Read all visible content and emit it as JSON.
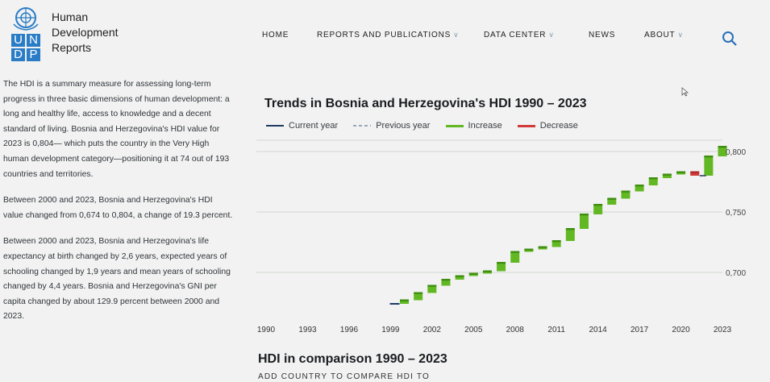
{
  "logo": {
    "letters": [
      "U",
      "N",
      "D",
      "P"
    ],
    "name_lines": [
      "Human",
      "Development",
      "Reports"
    ]
  },
  "nav": {
    "items": [
      {
        "label": "HOME",
        "dropdown": false
      },
      {
        "label": "REPORTS AND PUBLICATIONS",
        "dropdown": true
      },
      {
        "label": "DATA CENTER",
        "dropdown": true
      },
      {
        "label": "NEWS",
        "dropdown": false
      },
      {
        "label": "ABOUT",
        "dropdown": true
      }
    ],
    "search_icon": "search-icon"
  },
  "intro": {
    "paragraphs": [
      "The HDI is a summary measure for assessing long-term progress in three basic dimensions of human development: a long and healthy life, access to knowledge and a decent standard of living. Bosnia and Herzegovina's HDI value for 2023 is 0,804— which puts the country in the Very High human development category—positioning it at 74 out of 193 countries and territories.",
      "Between 2000 and 2023, Bosnia and Herzegovina's HDI value changed from 0,674 to 0,804, a change of 19.3 percent.",
      "Between 2000 and 2023, Bosnia and Herzegovina's life expectancy at birth changed by 2,6 years, expected years of schooling changed by 1,9 years and mean years of schooling changed by 4,4 years. Bosnia and Herzegovina's GNI per capita changed by about 129.9 percent between 2000 and 2023."
    ]
  },
  "chart_title": "Trends in Bosnia and Herzegovina's HDI 1990 – 2023",
  "legend": [
    {
      "label": "Current year",
      "color": "#1f3b63",
      "style": "solid"
    },
    {
      "label": "Previous year",
      "color": "#9aa7b8",
      "style": "dashed"
    },
    {
      "label": "Increase",
      "color": "#62b822",
      "style": "solid"
    },
    {
      "label": "Decrease",
      "color": "#d23a3a",
      "style": "solid"
    }
  ],
  "chart_data": {
    "type": "bar",
    "subtype": "waterfall",
    "x_ticks": [
      "1990",
      "1993",
      "1996",
      "1999",
      "2002",
      "2005",
      "2008",
      "2011",
      "2014",
      "2017",
      "2020",
      "2023"
    ],
    "y_ticks": [
      "0,700",
      "0,750",
      "0,800"
    ],
    "ylim": [
      0.672,
      0.808
    ],
    "grid": true,
    "series": [
      {
        "name": "Increase",
        "color": "#62b822",
        "points": [
          {
            "x": 2000,
            "from": 0.674,
            "to": 0.677
          },
          {
            "x": 2001,
            "from": 0.677,
            "to": 0.683
          },
          {
            "x": 2002,
            "from": 0.683,
            "to": 0.689
          },
          {
            "x": 2003,
            "from": 0.689,
            "to": 0.694
          },
          {
            "x": 2004,
            "from": 0.694,
            "to": 0.697
          },
          {
            "x": 2005,
            "from": 0.697,
            "to": 0.699
          },
          {
            "x": 2006,
            "from": 0.699,
            "to": 0.701
          },
          {
            "x": 2007,
            "from": 0.701,
            "to": 0.708
          },
          {
            "x": 2008,
            "from": 0.708,
            "to": 0.717
          },
          {
            "x": 2009,
            "from": 0.717,
            "to": 0.719
          },
          {
            "x": 2010,
            "from": 0.719,
            "to": 0.721
          },
          {
            "x": 2011,
            "from": 0.721,
            "to": 0.726
          },
          {
            "x": 2012,
            "from": 0.726,
            "to": 0.736
          },
          {
            "x": 2013,
            "from": 0.736,
            "to": 0.748
          },
          {
            "x": 2014,
            "from": 0.748,
            "to": 0.756
          },
          {
            "x": 2015,
            "from": 0.756,
            "to": 0.761
          },
          {
            "x": 2016,
            "from": 0.761,
            "to": 0.767
          },
          {
            "x": 2017,
            "from": 0.767,
            "to": 0.772
          },
          {
            "x": 2018,
            "from": 0.772,
            "to": 0.778
          },
          {
            "x": 2019,
            "from": 0.778,
            "to": 0.781
          },
          {
            "x": 2020,
            "from": 0.781,
            "to": 0.783
          },
          {
            "x": 2022,
            "from": 0.78,
            "to": 0.796
          },
          {
            "x": 2023,
            "from": 0.796,
            "to": 0.804
          }
        ]
      },
      {
        "name": "Decrease",
        "color": "#d23a3a",
        "points": [
          {
            "x": 2021,
            "from": 0.783,
            "to": 0.78
          }
        ]
      }
    ]
  },
  "comparison": {
    "title": "HDI in comparison 1990 – 2023",
    "add_country_label": "ADD COUNTRY TO COMPARE HDI TO"
  }
}
